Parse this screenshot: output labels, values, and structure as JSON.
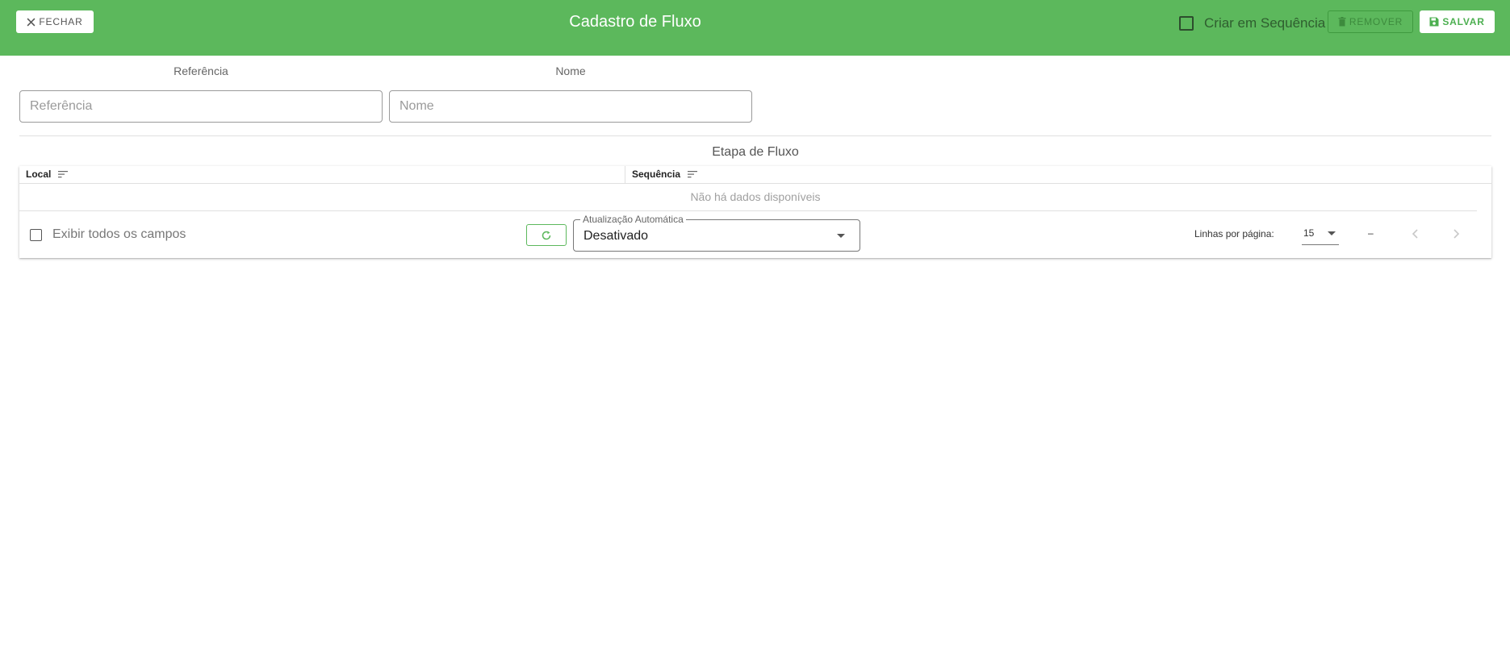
{
  "header": {
    "close_label": "Fechar",
    "title": "Cadastro de Fluxo",
    "sequence_checkbox_label": "Criar em Sequência",
    "remove_label": "Remover",
    "save_label": "Salvar",
    "bar_color": "#5cb85c"
  },
  "form": {
    "referencia": {
      "label": "Referência",
      "placeholder": "Referência",
      "value": ""
    },
    "nome": {
      "label": "Nome",
      "placeholder": "Nome",
      "value": ""
    }
  },
  "table": {
    "title": "Etapa de Fluxo",
    "columns": [
      "Local",
      "Sequência"
    ],
    "empty_text": "Não há dados disponíveis"
  },
  "footer": {
    "show_all_label": "Exibir todos os campos",
    "auto_refresh": {
      "legend": "Atualização Automática",
      "value": "Desativado"
    },
    "rows_per_page_label": "Linhas por página:",
    "rows_per_page_value": "15",
    "range_text": "–"
  },
  "icons": {
    "close": "close-icon",
    "trash": "trash-icon",
    "save": "floppy-disk-icon",
    "sort": "sort-icon",
    "refresh": "refresh-icon",
    "dropdown": "chevron-down-icon",
    "prev": "chevron-left-icon",
    "next": "chevron-right-icon"
  }
}
